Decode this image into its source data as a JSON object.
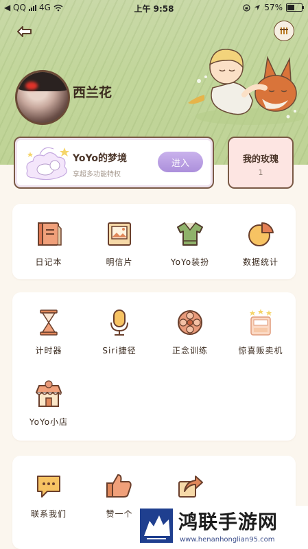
{
  "status_bar": {
    "back_app": "◀ QQ",
    "network": "4G",
    "time": "上午 9:58",
    "battery": "57%",
    "battery_level": 0.57
  },
  "profile": {
    "username": "西兰花"
  },
  "dream_card": {
    "title": "YoYo的梦境",
    "subtitle": "享超多功能特权",
    "enter_label": "进入"
  },
  "rose_card": {
    "title": "我的玫瑰",
    "count": "1"
  },
  "section1": {
    "items": [
      {
        "label": "日记本",
        "icon": "diary-icon"
      },
      {
        "label": "明信片",
        "icon": "postcard-icon"
      },
      {
        "label": "YoYo装扮",
        "icon": "sweater-icon"
      },
      {
        "label": "数据统计",
        "icon": "pie-chart-icon"
      }
    ]
  },
  "section2": {
    "items": [
      {
        "label": "计时器",
        "icon": "hourglass-icon"
      },
      {
        "label": "Siri捷径",
        "icon": "microphone-icon"
      },
      {
        "label": "正念训练",
        "icon": "flower-icon"
      },
      {
        "label": "惊喜贩卖机",
        "icon": "vending-machine-icon"
      },
      {
        "label": "YoYo小店",
        "icon": "shop-icon"
      }
    ]
  },
  "section3": {
    "items": [
      {
        "label": "联系我们",
        "icon": "chat-icon"
      },
      {
        "label": "赞一个",
        "icon": "thumbs-up-icon"
      },
      {
        "label": "",
        "icon": "share-icon"
      }
    ]
  },
  "watermark": {
    "title": "鸿联手游网",
    "url": "www.henanhonglian95.com"
  }
}
